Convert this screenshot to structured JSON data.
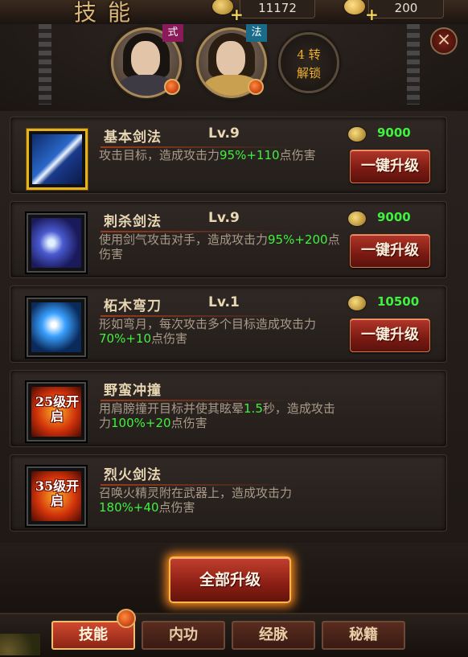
{
  "header": {
    "title": "技能",
    "resources": [
      {
        "icon": "copper-coin-icon",
        "value": "11172"
      },
      {
        "icon": "gold-ingot-icon",
        "value": "200"
      }
    ],
    "characters": [
      {
        "badge": "式",
        "badge_color": "#8a1a5a"
      },
      {
        "badge": "法",
        "badge_color": "#1a6a8a"
      }
    ],
    "locked_slot": {
      "line1": "4 转",
      "line2": "解锁"
    },
    "close_label": "×"
  },
  "skills": [
    {
      "name": "基本剑法",
      "level": "Lv.9",
      "cost": "9000",
      "art": "blue1",
      "selected": true,
      "desc": [
        {
          "t": "攻击目标，造成攻击力",
          "g": false
        },
        {
          "t": "95%+110",
          "g": true
        },
        {
          "t": "点伤害",
          "g": false
        }
      ],
      "button": "一键升级",
      "unlock_label": ""
    },
    {
      "name": "刺杀剑法",
      "level": "Lv.9",
      "cost": "9000",
      "art": "blue2",
      "selected": false,
      "desc": [
        {
          "t": "使用剑气攻击对手，造成攻击力",
          "g": false
        },
        {
          "t": "95%+200",
          "g": true
        },
        {
          "t": "点伤害",
          "g": false
        }
      ],
      "button": "一键升级",
      "unlock_label": ""
    },
    {
      "name": "柘木弯刀",
      "level": "Lv.1",
      "cost": "10500",
      "art": "blue3",
      "selected": false,
      "desc": [
        {
          "t": "形如弯月，每次攻击多个目标造成攻击力",
          "g": false
        },
        {
          "t": "70%+10",
          "g": true
        },
        {
          "t": "点伤害",
          "g": false
        }
      ],
      "button": "一键升级",
      "unlock_label": ""
    },
    {
      "name": "野蛮冲撞",
      "level": "",
      "cost": "",
      "art": "fire",
      "selected": false,
      "desc": [
        {
          "t": "用肩膀撞开目标并使其眩晕",
          "g": false
        },
        {
          "t": "1.5",
          "g": true
        },
        {
          "t": "秒，造成攻击力",
          "g": false
        },
        {
          "t": "100%+20",
          "g": true
        },
        {
          "t": "点伤害",
          "g": false
        }
      ],
      "button": "",
      "unlock_label": "25级开启"
    },
    {
      "name": "烈火剑法",
      "level": "",
      "cost": "",
      "art": "fire",
      "selected": false,
      "desc": [
        {
          "t": "召唤火精灵附在武器上，造成攻击力",
          "g": false
        },
        {
          "t": "180%+40",
          "g": true
        },
        {
          "t": "点伤害",
          "g": false
        }
      ],
      "button": "",
      "unlock_label": "35级开启"
    }
  ],
  "upgrade_all_label": "全部升级",
  "tabs": [
    {
      "label": "技能",
      "active": true
    },
    {
      "label": "内功",
      "active": false
    },
    {
      "label": "经脉",
      "active": false
    },
    {
      "label": "秘籍",
      "active": false
    }
  ]
}
